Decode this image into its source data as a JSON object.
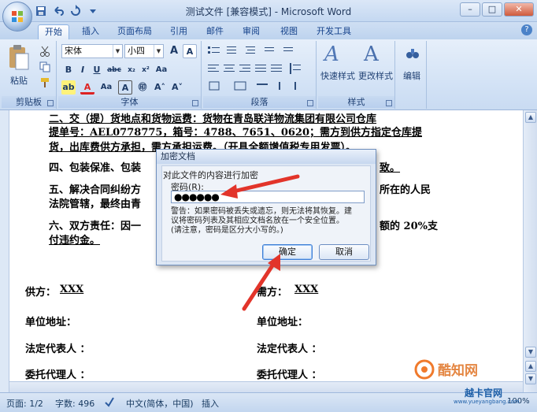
{
  "window": {
    "title": "测试文件 [兼容模式] - Microsoft Word"
  },
  "tabs": [
    {
      "label": "开始",
      "active": true
    },
    {
      "label": "插入"
    },
    {
      "label": "页面布局"
    },
    {
      "label": "引用"
    },
    {
      "label": "邮件"
    },
    {
      "label": "审阅"
    },
    {
      "label": "视图"
    },
    {
      "label": "开发工具"
    }
  ],
  "ribbon": {
    "clipboard": {
      "label": "剪贴板",
      "paste": "粘贴"
    },
    "font": {
      "label": "字体",
      "font_name": "宋体",
      "font_size": "小四"
    },
    "paragraph": {
      "label": "段落"
    },
    "styles": {
      "label": "样式",
      "quick_styles": "快速样式",
      "change_styles": "更改样式"
    },
    "editing": {
      "label": "编辑"
    }
  },
  "document": {
    "lines": [
      "二、交（提）货地点和货物运费：货物在青岛联洋物流集团有限公司仓库",
      "提单号：AEL0778775，箱号：4788、7651、0620；需方到供方指定仓库提",
      "货，出库费供方承担，需方承担运费。（开具全额增值税专用发票）。",
      "四、包装保准、包装",
      "致。",
      "五、解决合同纠纷方",
      "所在的人民",
      "法院管辖，最终由青",
      "六、双方责任：因一",
      "额的 20%支",
      "付违约金。",
      "供方：",
      "XXX",
      "需方：",
      "XXX",
      "单位地址：",
      "单位地址：",
      "法定代表人 ：",
      "法定代表人 ：",
      "委托代理人 ：",
      "委托代理人 ："
    ]
  },
  "dialog": {
    "title": "加密文档",
    "heading": "对此文件的内容进行加密",
    "password_label": "密码(R):",
    "password_value": "●●●●●●",
    "warning": "警告：如果密码被丢失或遗忘，则无法将其恢复。建\n议将密码列表及其相应文档名放在一个安全位置。\n(请注意，密码是区分大小写的。)",
    "ok": "确定",
    "cancel": "取消"
  },
  "status": {
    "page": "页面: 1/2",
    "words": "字数: 496",
    "language": "中文(简体，中国)",
    "mode": "插入",
    "zoom": "100%"
  },
  "watermark": {
    "brand": "酷知网",
    "site": "www.yueyangbang.com",
    "site_cn": "越卡官网"
  },
  "colors": {
    "accent_red": "#e2342a",
    "ribbon_blue": "#d4e3f6"
  }
}
